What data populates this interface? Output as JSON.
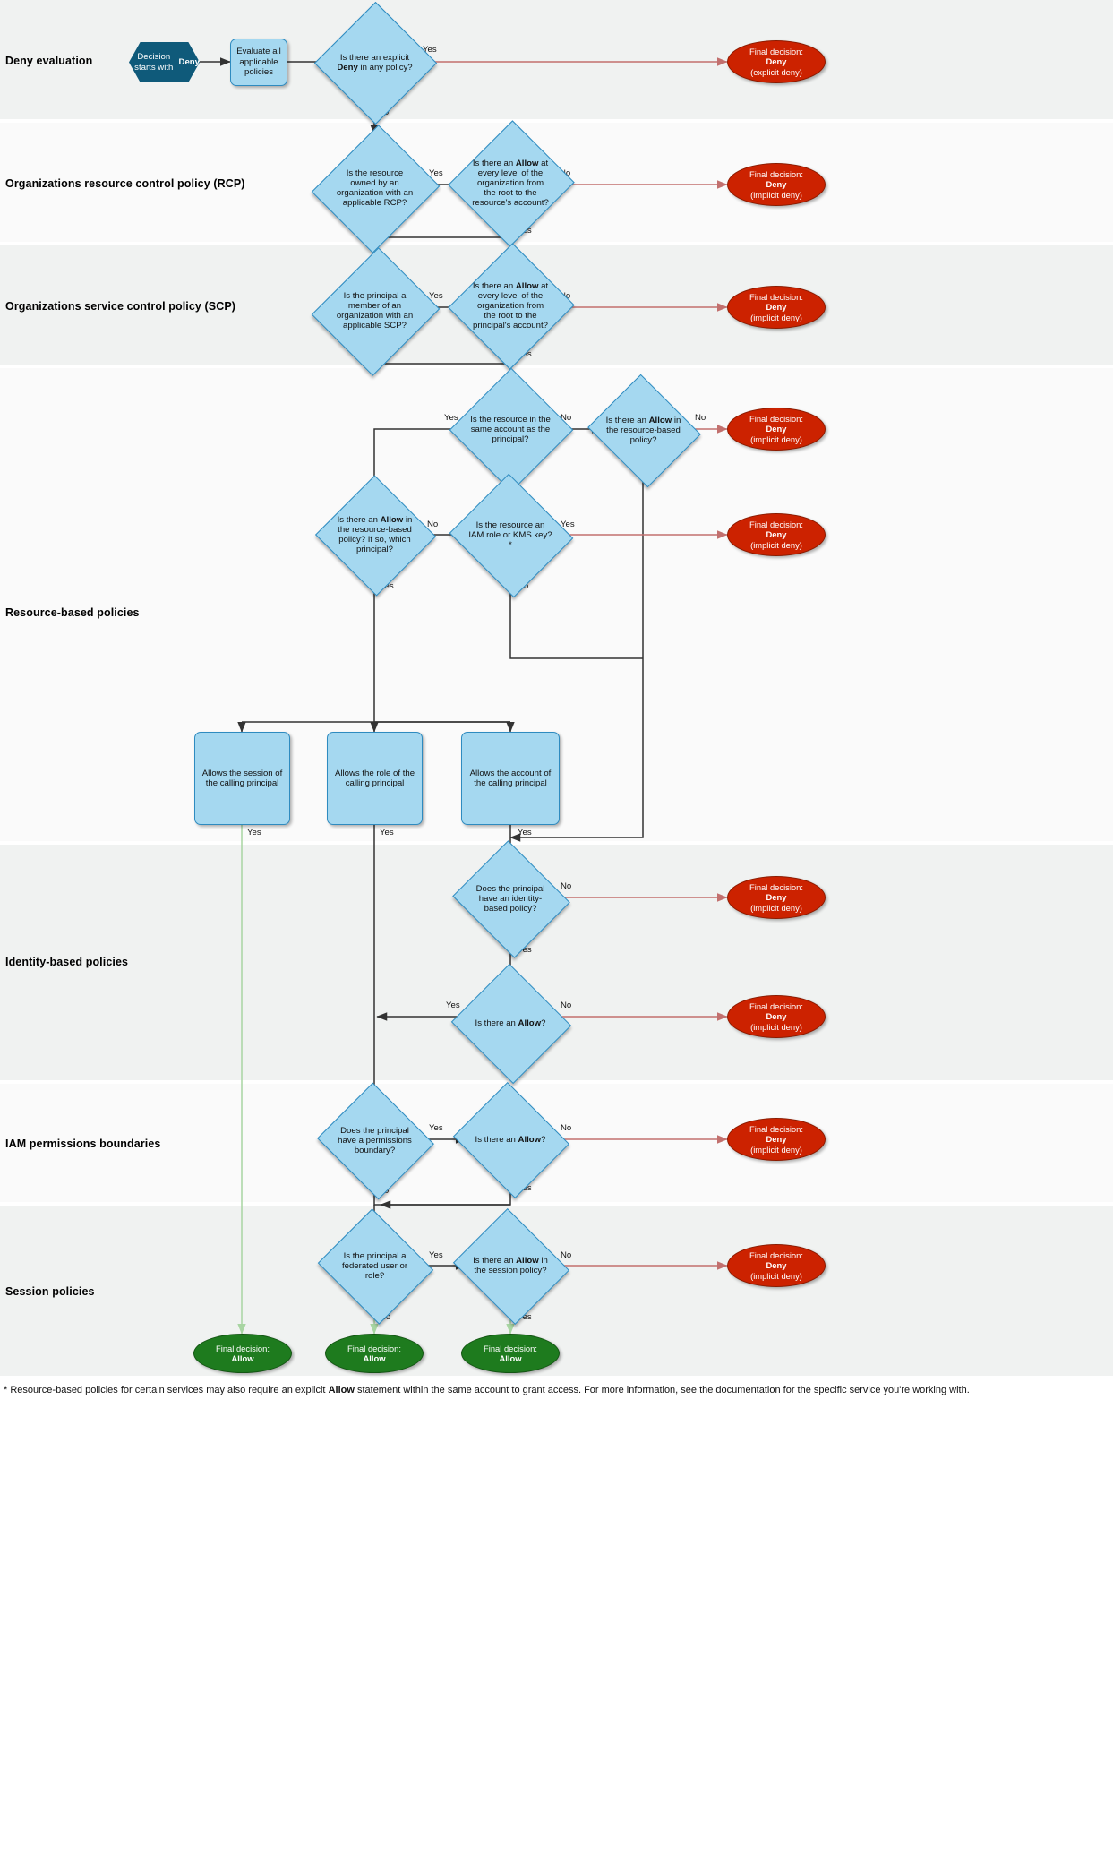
{
  "colors": {
    "node_fill": "#a5d8f0",
    "node_stroke": "#2e8bc0",
    "start_fill": "#0f5a7a",
    "deny_fill": "#cc2200",
    "allow_fill": "#1e7b1e",
    "deny_edge": "#c2706e",
    "allow_edge": "#a8d5a2",
    "band_shade": "#f0f2f1",
    "band_light": "#fafafa"
  },
  "bands": [
    {
      "label": "Deny evaluation"
    },
    {
      "label": "Organizations resource control policy (RCP)"
    },
    {
      "label": "Organizations service control policy (SCP)"
    },
    {
      "label": "Resource-based policies"
    },
    {
      "label": "Identity-based policies"
    },
    {
      "label": "IAM permissions boundaries"
    },
    {
      "label": "Session policies"
    }
  ],
  "nodes": {
    "start": "Decision starts with Deny",
    "evaluate": "Evaluate all applicable policies",
    "q_explicit_deny": "Is there an explicit Deny in any policy?",
    "q_rcp_owned": "Is the resource owned by an organization with an applicable RCP?",
    "q_rcp_allow": "Is there an Allow at every level of the organization from the root to the resource's account?",
    "q_scp_member": "Is the principal a member of an organization with an applicable SCP?",
    "q_scp_allow": "Is there an Allow at every level of the organization from the root to the principal's account?",
    "q_same_account": "Is the resource in the same account as the principal?",
    "q_rbp_allow_cross": "Is there an Allow in the resource-based policy?",
    "q_rbp_which": "Is there an Allow in the resource-based policy? If so, which principal?",
    "q_iam_role_kms": "Is the resource an IAM role or KMS key?*",
    "box_session": "Allows the session of the calling principal",
    "box_role": "Allows the role of the calling principal",
    "box_account": "Allows the account of the calling principal",
    "q_has_identity": "Does the principal have an identity-based policy?",
    "q_identity_allow": "Is there an Allow?",
    "q_has_boundary": "Does the principal have a permissions boundary?",
    "q_boundary_allow": "Is there an Allow?",
    "q_federated": "Is the principal a federated user or role?",
    "q_session_allow": "Is there an Allow in the session policy?"
  },
  "terminals": {
    "deny_explicit": {
      "line1": "Final decision:",
      "line2": "Deny",
      "line3": "(explicit deny)"
    },
    "deny_implicit": {
      "line1": "Final decision:",
      "line2": "Deny",
      "line3": "(implicit deny)"
    },
    "allow": {
      "line1": "Final decision:",
      "line2": "Allow"
    }
  },
  "edge_labels": {
    "yes": "Yes",
    "no": "No"
  },
  "footnote": {
    "part1": "* Resource-based policies for certain services may also require an explicit ",
    "bold": "Allow",
    "part2": " statement within the same account to grant access. For more information, see the documentation for the specific service you're working with."
  }
}
